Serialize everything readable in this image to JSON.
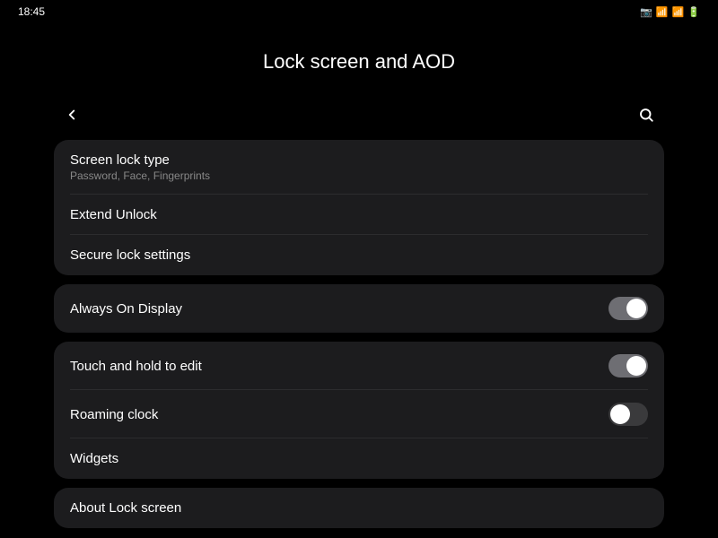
{
  "statusBar": {
    "time": "18:45",
    "icons": "📷 WiFi LTE 📶 🔋"
  },
  "header": {
    "title": "Lock screen and AOD"
  },
  "nav": {
    "back_label": "‹",
    "search_label": "🔍"
  },
  "cards": {
    "security": {
      "items": [
        {
          "id": "screen-lock-type",
          "title": "Screen lock type",
          "subtitle": "Password, Face, Fingerprints"
        },
        {
          "id": "extend-unlock",
          "title": "Extend Unlock",
          "subtitle": ""
        },
        {
          "id": "secure-lock-settings",
          "title": "Secure lock settings",
          "subtitle": ""
        }
      ]
    },
    "display": {
      "items": [
        {
          "id": "always-on-display",
          "title": "Always On Display",
          "toggle": true,
          "toggleState": "on"
        }
      ]
    },
    "interaction": {
      "items": [
        {
          "id": "touch-and-hold",
          "title": "Touch and hold to edit",
          "toggle": true,
          "toggleState": "on"
        },
        {
          "id": "roaming-clock",
          "title": "Roaming clock",
          "toggle": true,
          "toggleState": "off"
        },
        {
          "id": "widgets",
          "title": "Widgets",
          "toggle": false
        }
      ]
    },
    "about": {
      "title": "About Lock screen"
    }
  }
}
